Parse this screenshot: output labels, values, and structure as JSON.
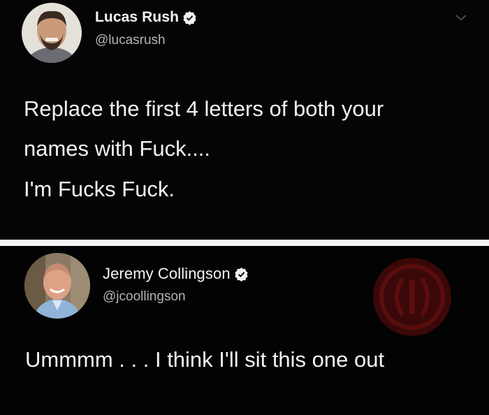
{
  "tweets": [
    {
      "name": "Lucas Rush",
      "handle": "@lucasrush",
      "verified": true,
      "lines": [
        "Replace the first 4 letters of both your",
        "names with Fuck...."
      ],
      "extra_line": "I'm Fucks Fuck."
    },
    {
      "name": "Jeremy Collingson",
      "handle": "@jcoollingson",
      "verified": true,
      "text": "Ummmm . . . I think I'll sit this one out"
    }
  ],
  "colors": {
    "background": "#000000",
    "divider": "#f4f4f4",
    "text": "#f2f2f2",
    "handle": "#b4b4b4",
    "watermark": "#5a0d0d"
  },
  "icons": [
    "verified-badge-icon",
    "chevron-down-icon",
    "watermark-logo-icon"
  ]
}
